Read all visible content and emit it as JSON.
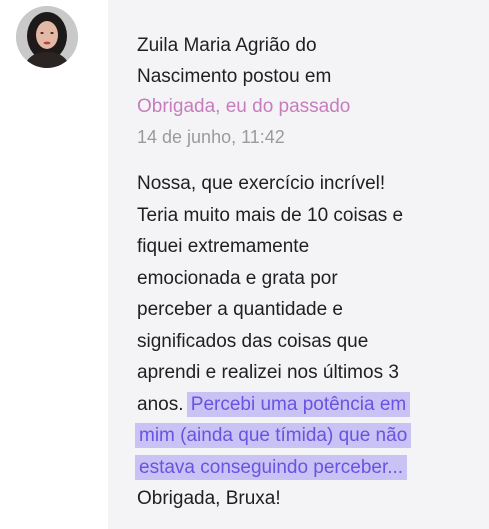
{
  "post": {
    "author_line1": "Zuila Maria Agrião do",
    "author_line2": "Nascimento postou em",
    "topic_link": "Obrigada, eu do passado",
    "timestamp": "14 de junho, 11:42",
    "body": {
      "line1": "Nossa, que exercício incrível!",
      "line2": "Teria muito mais de 10 coisas e",
      "line3": "fiquei extremamente",
      "line4": "emocionada e grata por",
      "line5": "perceber a quantidade e",
      "line6": "significados das coisas que",
      "line7": "aprendi e realizei nos últimos 3",
      "line8_plain": "anos.",
      "line8_highlight": "Percebi uma potência em",
      "line9_highlight": "mim (ainda que tímida) que não",
      "line10_highlight": "estava conseguindo perceber...",
      "line11": "Obrigada, Bruxa!"
    }
  },
  "colors": {
    "card_background": "#f4f4f6",
    "link": "#c77dbd",
    "timestamp": "#9a9a9a",
    "highlight_background": "#c9c2f5",
    "highlight_text": "#6b52e0"
  },
  "icons": {
    "avatar": "user-avatar-photo"
  }
}
